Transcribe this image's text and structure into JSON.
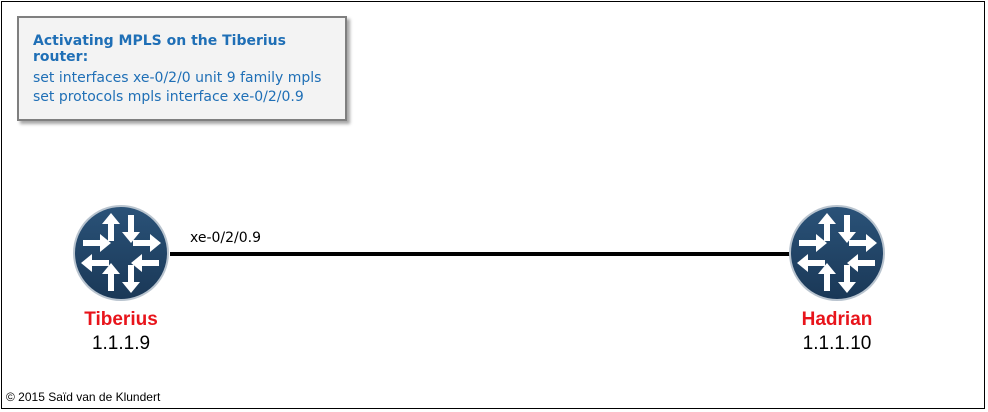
{
  "note": {
    "title": "Activating MPLS on the Tiberius router:",
    "commands": [
      "set interfaces xe-0/2/0 unit 9 family mpls",
      "set protocols mpls interface xe-0/2/0.9"
    ]
  },
  "link": {
    "interface_label": "xe-0/2/0.9"
  },
  "routers": [
    {
      "name": "Tiberius",
      "ip": "1.1.1.9",
      "icon": "router-icon"
    },
    {
      "name": "Hadrian",
      "ip": "1.1.1.10",
      "icon": "router-icon"
    }
  ],
  "colors": {
    "router_fill": "#1f4364",
    "router_name": "#e8141b",
    "note_text": "#1f6fb6"
  },
  "copyright": "© 2015 Saïd van de Klundert"
}
